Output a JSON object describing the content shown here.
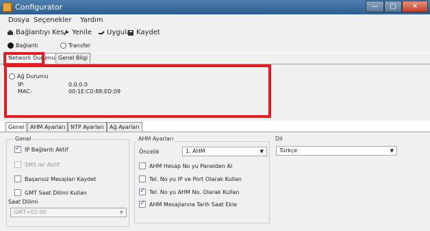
{
  "window": {
    "title": "Configurator",
    "min": "—",
    "max": "□",
    "close": "✕"
  },
  "menu": {
    "items": [
      "Dosya",
      "Seçenekler",
      "Yardım"
    ]
  },
  "toolbar": {
    "disconnect": "Bağlantıyı Kes",
    "refresh": "Yenile",
    "apply": "Uygula",
    "save": "Kaydet"
  },
  "mode": {
    "connection": "Bağlantı",
    "transfer": "Transfer",
    "selected": "connection"
  },
  "top_tabs": {
    "network": "Network Durumu",
    "general_info": "Genel Bilgi",
    "active": "network"
  },
  "network": {
    "status_label": "Ağ Durumu",
    "ip_label": "IP:",
    "ip_value": "0.0.0.0",
    "mac_label": "MAC:",
    "mac_value": "00:1E:C0:88:ED:09"
  },
  "tabs2": {
    "items": [
      "Genel",
      "AHM Ayarları",
      "NTP Ayarları",
      "Ağ Ayarları"
    ],
    "active": "Genel"
  },
  "genel": {
    "title": "Genel",
    "ip_connection": {
      "label": "IP Bağlantı Aktif",
      "checked": true
    },
    "sms": {
      "label": "SMS ler Aktif",
      "enabled": false,
      "checked": false
    },
    "failed_messages": {
      "label": "Başarısız Mesajları Kaydet",
      "checked": false
    },
    "gmt": {
      "label": "GMT Saat Dilimi Kullan",
      "checked": false
    },
    "timezone_label": "Saat Dilimi",
    "timezone_value": "GMT+02:00"
  },
  "ahm": {
    "title": "AHM Ayarları",
    "priority_label": "Öncelik",
    "priority_value": "1. AHM",
    "items": [
      {
        "label": "AHM Hesap No yu Panelden Al",
        "checked": false
      },
      {
        "label": "Tel. No yu IP ve Port Olarak Kullan",
        "checked": false
      },
      {
        "label": "Tel. No yu AHM No. Olarak Kullan",
        "checked": true
      },
      {
        "label": "AHM Mesajlarına Tarih Saat Ekle",
        "checked": true
      }
    ]
  },
  "dil": {
    "title": "Dil",
    "value": "Türkçe"
  }
}
